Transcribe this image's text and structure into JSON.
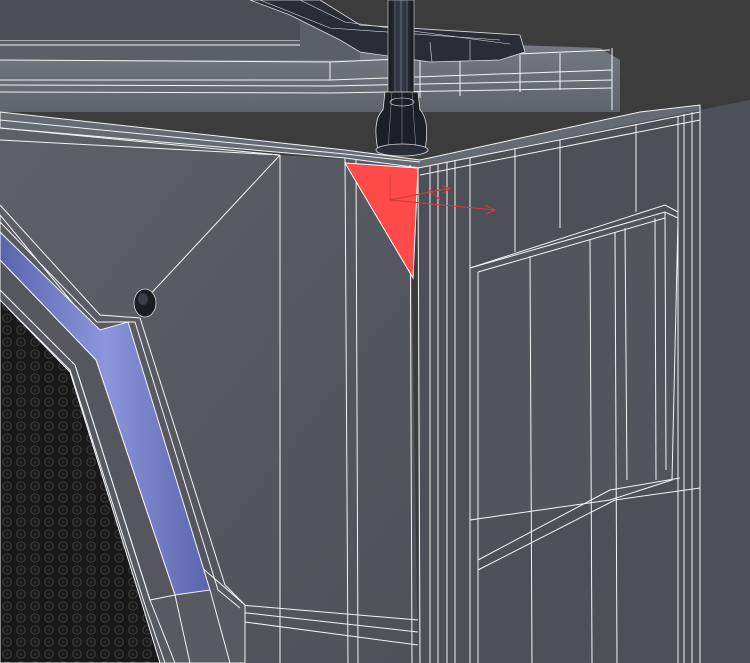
{
  "viewport": {
    "name": "3d-viewport",
    "render_mode": "shaded-wireframe",
    "background_color": "#3c3c3c"
  },
  "colors": {
    "face_top": "#6a6e77",
    "face_front": "#575a61",
    "face_side": "#4d5057",
    "face_panel": "#52555c",
    "wire": "#f4f4f4",
    "selection": "#ff4a4a",
    "bezel_blue": "#7b85cf",
    "mesh_grille": "#1e1e1e"
  },
  "selection": {
    "selected_element": "polygon-face",
    "state": "selected"
  },
  "gizmo": {
    "type": "transform-gizmo",
    "axis_color": "#d23c3c"
  },
  "scene_objects": [
    "cabinet-body",
    "front-panel",
    "handle",
    "pin-rod",
    "rivet",
    "speaker-grille",
    "recessed-side-panel"
  ]
}
